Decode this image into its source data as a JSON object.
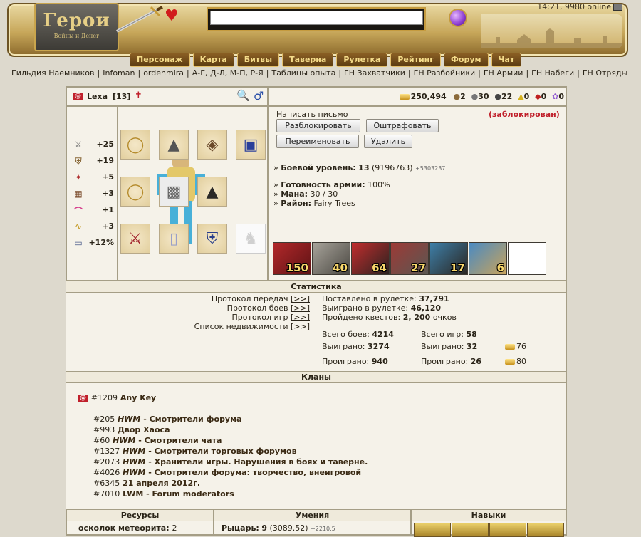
{
  "header": {
    "logo_big": "Герои",
    "logo_small": "Войны и Денег",
    "clock": "14:21, 9980 online",
    "chat_value": ""
  },
  "nav": [
    "Персонаж",
    "Карта",
    "Битвы",
    "Таверна",
    "Рулетка",
    "Рейтинг",
    "Форум",
    "Чат"
  ],
  "links": [
    "Гильдия Наемников",
    "Infoman",
    "ordenmira",
    "А-Г, Д-Л, М-П, Р-Я",
    "Таблицы опыта",
    "ГН Захватчики",
    "ГН Разбойники",
    "ГН Армии",
    "ГН Набеги",
    "ГН Отряды"
  ],
  "player": {
    "name": "Lexa",
    "level_bracket": "[13]",
    "gold": "250,494",
    "res": [
      "2",
      "30",
      "22",
      "0",
      "0",
      "0"
    ]
  },
  "stats": [
    "+25",
    "+19",
    "+5",
    "+3",
    "+1",
    "+3",
    "+12%"
  ],
  "info": {
    "write_letter": "Написать письмо",
    "blocked": "(заблокирован)",
    "btn_unblock": "Разблокировать",
    "btn_fine": "Оштрафовать",
    "btn_rename": "Переименовать",
    "btn_delete": "Удалить",
    "combat_label": "Боевой уровень:",
    "combat_value": "13",
    "combat_exp": "(9196763)",
    "combat_plus": "+5303237",
    "army_label": "Готовность армии:",
    "army_value": "100%",
    "mana_label": "Мана:",
    "mana_value": "30 / 30",
    "district_label": "Район:",
    "district_value": "Fairy Trees",
    "units": [
      "150",
      "40",
      "64",
      "27",
      "17",
      "6"
    ]
  },
  "statistics": {
    "title": "Статистика",
    "links": [
      "Протокол передач",
      "Протокол боев",
      "Протокол игр",
      "Список недвижимости"
    ],
    "link_tag": "[>>]",
    "roulette_bet_label": "Поставлено в рулетке:",
    "roulette_bet": "37,791",
    "roulette_won_label": "Выиграно в рулетке:",
    "roulette_won": "46,120",
    "quests_label": "Пройдено квестов:",
    "quests": "2, 200",
    "quests_unit": "очков",
    "battles_label": "Всего боев:",
    "battles": "4214",
    "games_label": "Всего игр:",
    "games": "58",
    "won_label": "Выиграно:",
    "battles_won": "3274",
    "games_won": "32",
    "won_gold": "76",
    "lost_label": "Проиграно:",
    "battles_lost": "940",
    "games_lost": "26",
    "lost_gold": "80"
  },
  "clans": {
    "title": "Кланы",
    "main": {
      "num": "#1209",
      "name": "Any Key"
    },
    "list": [
      {
        "num": "#205",
        "pre": "HWM",
        "name": " - Смотрители форума"
      },
      {
        "num": "#993",
        "pre": "",
        "name": "Двор Хаоса"
      },
      {
        "num": "#60",
        "pre": "HWM",
        "name": " - Смотрители чата"
      },
      {
        "num": "#1327",
        "pre": "HWM",
        "name": " - Смотрители торговых форумов"
      },
      {
        "num": "#2073",
        "pre": "HWM",
        "name": " - Хранители игры. Нарушения в боях и таверне."
      },
      {
        "num": "#4026",
        "pre": "HWM",
        "name": " - Смотрители форума: творчество, внеигровой"
      },
      {
        "num": "#6345",
        "pre": "",
        "name": "21 апреля 2012г."
      },
      {
        "num": "#7010",
        "pre": "",
        "name": "LWM - Forum moderators"
      }
    ]
  },
  "bottom": {
    "resources_title": "Ресурсы",
    "skills_title": "Умения",
    "talents_title": "Навыки",
    "res_line_label": "осколок метеорита:",
    "res_line_value": "2",
    "skill_label": "Рыцарь:",
    "skill_value": "9",
    "skill_exp": "(3089.52)",
    "skill_plus": "+2210.5"
  }
}
